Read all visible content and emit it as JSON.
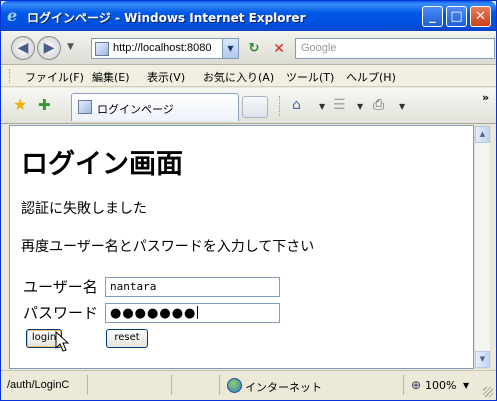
{
  "window": {
    "title": "ログインページ - Windows Internet Explorer",
    "controls": {
      "minimize": "_",
      "maximize": "□",
      "close": "✕"
    }
  },
  "address_bar": {
    "url": "http://localhost:8080",
    "search_placeholder": "Google"
  },
  "menu": [
    "ファイル(F)",
    "編集(E)",
    "表示(V)",
    "お気に入り(A)",
    "ツール(T)",
    "ヘルプ(H)"
  ],
  "tab": {
    "label": "ログインページ"
  },
  "page": {
    "heading": "ログイン画面",
    "error_message": "認証に失敗しました",
    "prompt_message": "再度ユーザー名とパスワードを入力して下さい",
    "username_label": "ユーザー名",
    "username_value": "nantara",
    "password_label": "パスワード",
    "password_masked": "●●●●●●●",
    "login_button": "login",
    "reset_button": "reset"
  },
  "status_bar": {
    "url": "/auth/LoginC",
    "zone": "インターネット",
    "zoom": "100%"
  },
  "icons": {
    "ie_logo": "ie-logo-icon",
    "back": "back-arrow-icon",
    "forward": "forward-arrow-icon",
    "refresh": "refresh-icon",
    "stop": "stop-icon",
    "favorites": "favorites-star-icon",
    "add_favorite": "add-favorite-icon",
    "home": "home-icon",
    "feeds": "feeds-icon",
    "print": "print-icon",
    "globe": "globe-icon",
    "zoom": "zoom-icon"
  },
  "colors": {
    "titlebar": "#0058e6",
    "window_frame": "#ece9d8",
    "close_button": "#c8431c"
  }
}
